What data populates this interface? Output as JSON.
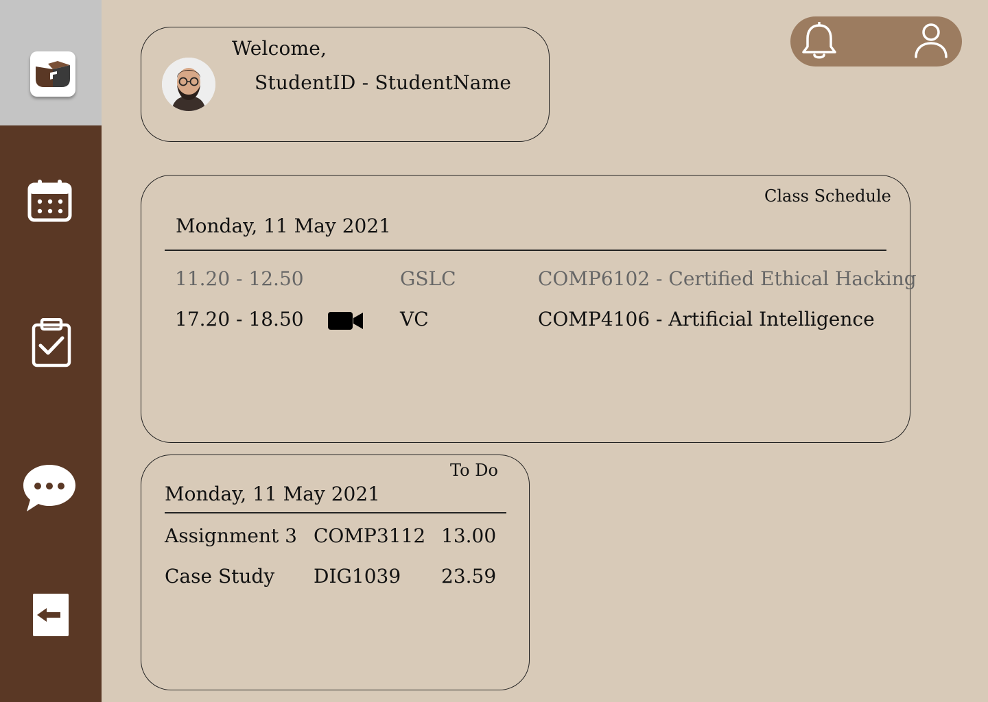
{
  "sidebar": {
    "logo_icon": "book-logo-icon",
    "items": [
      {
        "name": "calendar",
        "icon": "calendar-icon"
      },
      {
        "name": "assignments",
        "icon": "clipboard-check-icon"
      },
      {
        "name": "chat",
        "icon": "chat-bubble-icon"
      },
      {
        "name": "logout",
        "icon": "logout-arrow-icon"
      }
    ]
  },
  "header": {
    "welcome": "Welcome,",
    "student": "StudentID - StudentName",
    "notification_icon": "bell-icon",
    "profile_icon": "user-icon"
  },
  "schedule": {
    "label": "Class Schedule",
    "date": "Monday, 11 May 2021",
    "rows": [
      {
        "time": "11.20 - 12.50",
        "type": "GSLC",
        "course": "COMP6102 - Certified Ethical Hacking",
        "muted": true,
        "icon": ""
      },
      {
        "time": "17.20 - 18.50",
        "type": "VC",
        "course": "COMP4106 -  Artificial Intelligence",
        "muted": false,
        "icon": "video-camera-icon"
      }
    ]
  },
  "todo": {
    "label": "To Do",
    "date": "Monday, 11 May 2021",
    "rows": [
      {
        "task": "Assignment 3",
        "course": "COMP3112",
        "due": "13.00"
      },
      {
        "task": "Case Study",
        "course": "DIG1039",
        "due": "23.59"
      }
    ]
  },
  "colors": {
    "background": "#d8cab8",
    "sidebar": "#5a3825",
    "sidebar_top": "#c4c4c4",
    "topbar": "#9c7c60"
  }
}
